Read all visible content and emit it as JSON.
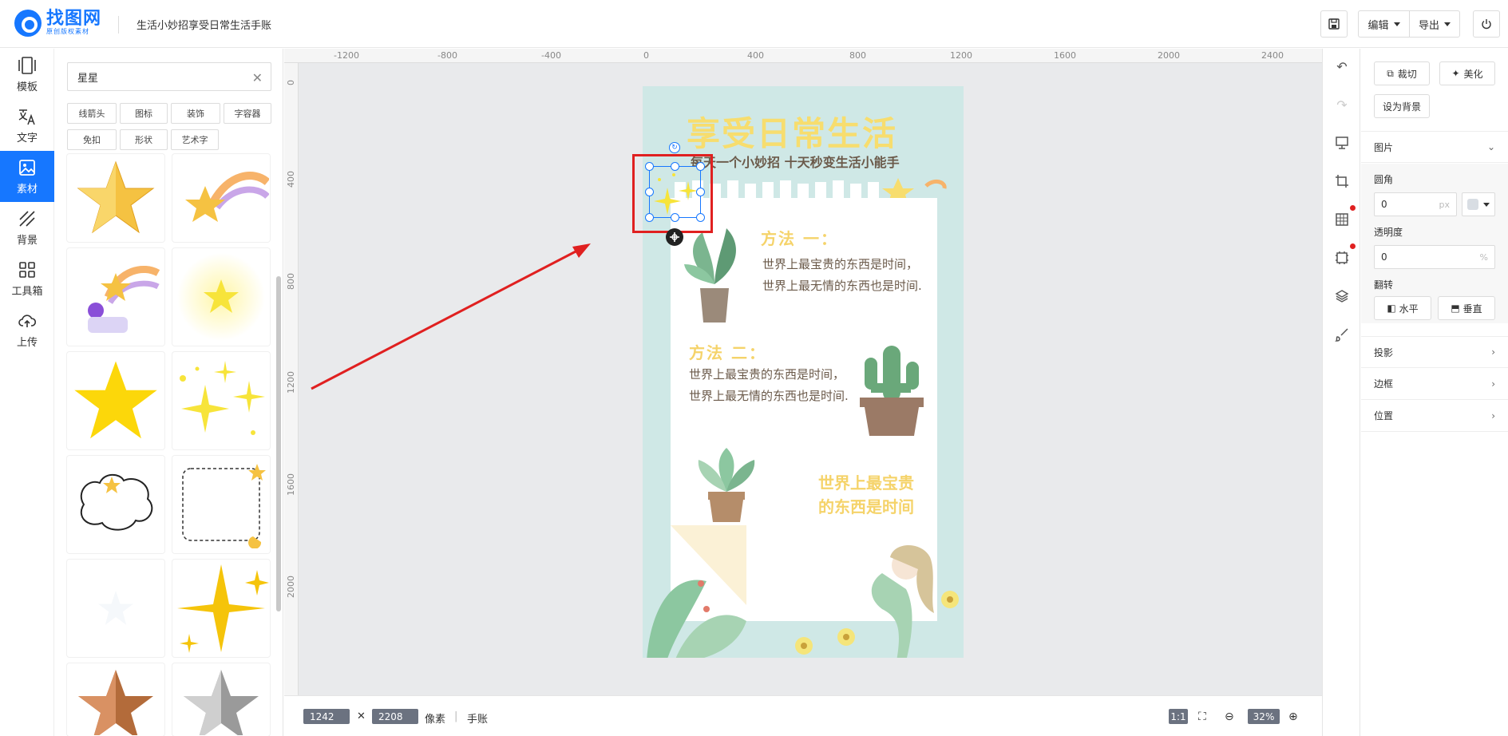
{
  "header": {
    "logo_title": "找图网",
    "logo_sub": "原创版权素材",
    "doc_title": "生活小妙招享受日常生活手账",
    "edit_label": "编辑",
    "export_label": "导出"
  },
  "leftnav": {
    "items": [
      {
        "label": "模板",
        "icon": "template-icon"
      },
      {
        "label": "文字",
        "icon": "text-icon"
      },
      {
        "label": "素材",
        "icon": "image-icon"
      },
      {
        "label": "背景",
        "icon": "background-icon"
      },
      {
        "label": "工具箱",
        "icon": "toolbox-icon"
      },
      {
        "label": "上传",
        "icon": "upload-icon"
      }
    ]
  },
  "panel": {
    "search_value": "星星",
    "tags": [
      "线箭头",
      "图标",
      "装饰",
      "字容器",
      "免扣",
      "形状",
      "艺术字"
    ]
  },
  "ruler": {
    "h_labels": [
      "-1200",
      "-800",
      "-400",
      "0",
      "400",
      "800",
      "1200",
      "1600",
      "2000",
      "2400"
    ],
    "v_labels": [
      "0",
      "400",
      "800",
      "1200",
      "1600",
      "2000"
    ]
  },
  "poster": {
    "title": "享受日常生活",
    "subtitle": "每天一个小妙招 十天秒变生活小能手",
    "method1_title": "方法 一：",
    "method1_text": "世界上最宝贵的东西是时间，世界上最无情的东西也是时间.",
    "method2_title": "方法 二：",
    "method2_text": "世界上最宝贵的东西是时间，世界上最无情的东西也是时间.",
    "slogan_line1": "世界上最宝贵",
    "slogan_line2": "的东西是时间"
  },
  "bottombar": {
    "width": "1242",
    "height": "2208",
    "unit": "像素",
    "type": "手账",
    "ratio": "1:1",
    "zoom": "32%"
  },
  "props": {
    "crop_label": "裁切",
    "beautify_label": "美化",
    "set_bg_label": "设为背景",
    "section_image": "图片",
    "radius_label": "圆角",
    "radius_value": "0",
    "radius_unit": "px",
    "opacity_label": "透明度",
    "opacity_value": "0",
    "opacity_unit": "%",
    "flip_label": "翻转",
    "flip_h": "水平",
    "flip_v": "垂直",
    "shadow_label": "投影",
    "border_label": "边框",
    "position_label": "位置"
  },
  "colors": {
    "accent": "#1677ff",
    "poster_bg": "#cfe8e6",
    "poster_yellow": "#f5d36a",
    "selection_red": "#e02020"
  }
}
